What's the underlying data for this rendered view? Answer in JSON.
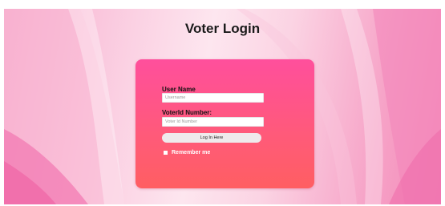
{
  "page": {
    "title": "Voter Login"
  },
  "form": {
    "username_label": "User Name",
    "username_placeholder": "Username",
    "username_value": "",
    "voterid_label": "VoterId Number:",
    "voterid_placeholder": "Voter Id Number",
    "voterid_value": "",
    "login_button_label": "Log In Here",
    "remember_label": "Remember me",
    "remember_checked": false
  },
  "colors": {
    "card_top": "#ff4f9c",
    "card_bottom": "#ff5e62",
    "background_light": "#fde6ef",
    "background_accent": "#f389b8"
  }
}
